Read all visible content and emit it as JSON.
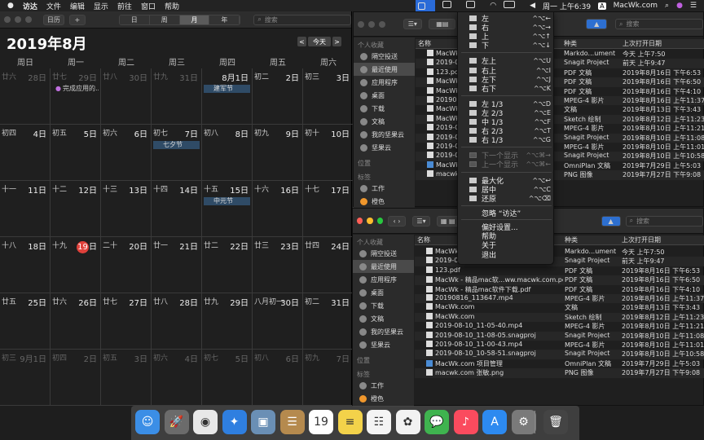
{
  "menubar": {
    "items": [
      "访达",
      "文件",
      "编辑",
      "显示",
      "前往",
      "窗口",
      "帮助"
    ],
    "clock": "周一 上午6:39",
    "site": "MacWk.com"
  },
  "calendar": {
    "toolbar": {
      "calendars_label": "日历",
      "add_label": "+",
      "views": [
        "日",
        "周",
        "月",
        "年"
      ],
      "selected_view": "月",
      "search_placeholder": "搜索"
    },
    "title": "2019年8月",
    "today_button": "今天",
    "prev": "<",
    "next": ">",
    "weekdays": [
      "周日",
      "周一",
      "周二",
      "周三",
      "周四",
      "周五",
      "周六"
    ],
    "weeks": [
      [
        {
          "l": "廿六",
          "d": "28日",
          "dim": true
        },
        {
          "l": "廿七",
          "d": "29日",
          "dim": true
        },
        {
          "l": "廿八",
          "d": "30日",
          "dim": true
        },
        {
          "l": "廿九",
          "d": "31日",
          "dim": true
        },
        {
          "l": "",
          "d": "8月1日"
        },
        {
          "l": "初二",
          "d": "2日"
        },
        {
          "l": "初三",
          "d": "3日"
        }
      ],
      [
        {
          "l": "初四",
          "d": "4日"
        },
        {
          "l": "初五",
          "d": "5日"
        },
        {
          "l": "初六",
          "d": "6日"
        },
        {
          "l": "初七",
          "d": "7日"
        },
        {
          "l": "初八",
          "d": "8日"
        },
        {
          "l": "初九",
          "d": "9日"
        },
        {
          "l": "初十",
          "d": "10日"
        }
      ],
      [
        {
          "l": "十一",
          "d": "11日"
        },
        {
          "l": "十二",
          "d": "12日"
        },
        {
          "l": "十三",
          "d": "13日"
        },
        {
          "l": "十四",
          "d": "14日"
        },
        {
          "l": "十五",
          "d": "15日"
        },
        {
          "l": "十六",
          "d": "16日"
        },
        {
          "l": "十七",
          "d": "17日"
        }
      ],
      [
        {
          "l": "十八",
          "d": "18日"
        },
        {
          "l": "十九",
          "d": "19",
          "today": true
        },
        {
          "l": "二十",
          "d": "20日"
        },
        {
          "l": "廿一",
          "d": "21日"
        },
        {
          "l": "廿二",
          "d": "22日"
        },
        {
          "l": "廿三",
          "d": "23日"
        },
        {
          "l": "廿四",
          "d": "24日"
        }
      ],
      [
        {
          "l": "廿五",
          "d": "25日"
        },
        {
          "l": "廿六",
          "d": "26日"
        },
        {
          "l": "廿七",
          "d": "27日"
        },
        {
          "l": "廿八",
          "d": "28日"
        },
        {
          "l": "廿九",
          "d": "29日"
        },
        {
          "l": "八月初一",
          "d": "30日"
        },
        {
          "l": "初二",
          "d": "31日"
        }
      ],
      [
        {
          "l": "初三",
          "d": "9月1日",
          "dim": true
        },
        {
          "l": "初四",
          "d": "2日",
          "dim": true
        },
        {
          "l": "初五",
          "d": "3日",
          "dim": true
        },
        {
          "l": "初六",
          "d": "4日",
          "dim": true
        },
        {
          "l": "初七",
          "d": "5日",
          "dim": true
        },
        {
          "l": "初八",
          "d": "6日",
          "dim": true
        },
        {
          "l": "初九",
          "d": "7日",
          "dim": true
        }
      ]
    ],
    "events": [
      {
        "w": 0,
        "c": 1,
        "text": "完成应用的...",
        "plain": true
      },
      {
        "w": 0,
        "c": 4,
        "text": "建军节"
      },
      {
        "w": 1,
        "c": 3,
        "text": "七夕节"
      },
      {
        "w": 2,
        "c": 4,
        "text": "中元节"
      }
    ]
  },
  "finder_back": {
    "search_placeholder": "搜索",
    "columns": {
      "name": "名称",
      "kind": "种类",
      "date": "上次打开日期"
    },
    "rows": [
      {
        "name": "MacWk",
        "kind": "Markdo...ument",
        "date": "今天 上午7:50"
      },
      {
        "name": "2019-0",
        "kind": "Snagit Project",
        "date": "前天 上午9:47"
      },
      {
        "name": "123.pdf",
        "kind": "PDF 文稿",
        "date": "2019年8月16日 下午6:53"
      },
      {
        "name": "MacWk",
        "kind": "PDF 文稿",
        "date": "2019年8月16日 下午6:50"
      },
      {
        "name": "MacWk",
        "kind": "PDF 文稿",
        "date": "2019年8月16日 下午4:10"
      },
      {
        "name": "2019081",
        "kind": "MPEG-4 影片",
        "date": "2019年8月16日 上午11:37"
      },
      {
        "name": "MacWk",
        "kind": "文稿",
        "date": "2019年8月13日 下午3:43"
      },
      {
        "name": "MacWk",
        "kind": "Sketch 绘制",
        "date": "2019年8月12日 上午11:23"
      },
      {
        "name": "2019-0",
        "kind": "MPEG-4 影片",
        "date": "2019年8月10日 上午11:21"
      },
      {
        "name": "2019-0",
        "kind": "Snagit Project",
        "date": "2019年8月10日 上午11:08"
      },
      {
        "name": "2019-0",
        "kind": "MPEG-4 影片",
        "date": "2019年8月10日 上午11:01"
      },
      {
        "name": "2019-0",
        "kind": "Snagit Project",
        "date": "2019年8月10日 上午10:58"
      },
      {
        "name": "MacWk",
        "kind": "OmniPlan 文稿",
        "date": "2019年7月29日 上午5:03"
      },
      {
        "name": "macwk",
        "kind": "PNG 图像",
        "date": "2019年7月27日 下午9:08"
      }
    ]
  },
  "finder_front": {
    "search_placeholder": "搜索",
    "sidebar": {
      "fav_label": "个人收藏",
      "favs": [
        "隔空投送",
        "最近使用",
        "应用程序",
        "桌面",
        "下载",
        "文稿",
        "我的坚果云",
        "坚果云"
      ],
      "loc_label": "位置",
      "tag_label": "标签",
      "tags": [
        "工作",
        "橙色"
      ]
    },
    "columns": {
      "name": "名称",
      "kind": "种类",
      "date": "上次打开日期"
    },
    "rows": [
      {
        "name": "MacWk",
        "kind": "Markdo...ument",
        "date": "今天 上午7:50"
      },
      {
        "name": "2019-0",
        "kind": "Snagit Project",
        "date": "前天 上午9:47"
      },
      {
        "name": "123.pdf",
        "kind": "PDF 文稿",
        "date": "2019年8月16日 下午6:53"
      },
      {
        "name": "MacWk - 精品mac软...ww.macwk.com.pdf",
        "kind": "PDF 文稿",
        "date": "2019年8月16日 下午6:50"
      },
      {
        "name": "MacWk - 精品mac软件下载.pdf",
        "kind": "PDF 文稿",
        "date": "2019年8月16日 下午4:10"
      },
      {
        "name": "20190816_113647.mp4",
        "kind": "MPEG-4 影片",
        "date": "2019年8月16日 上午11:37"
      },
      {
        "name": "MacWk.com",
        "kind": "文稿",
        "date": "2019年8月13日 下午3:43"
      },
      {
        "name": "MacWk.com",
        "kind": "Sketch 绘制",
        "date": "2019年8月12日 上午11:23"
      },
      {
        "name": "2019-08-10_11-05-40.mp4",
        "kind": "MPEG-4 影片",
        "date": "2019年8月10日 上午11:21"
      },
      {
        "name": "2019-08-10_11-08-05.snagproj",
        "kind": "Snagit Project",
        "date": "2019年8月10日 上午11:08"
      },
      {
        "name": "2019-08-10_11-00-43.mp4",
        "kind": "MPEG-4 影片",
        "date": "2019年8月10日 上午11:01"
      },
      {
        "name": "2019-08-10_10-58-51.snagproj",
        "kind": "Snagit Project",
        "date": "2019年8月10日 上午10:58"
      },
      {
        "name": "MacWk.com 项目管理",
        "kind": "OmniPlan 文稿",
        "date": "2019年7月29日 上午5:03"
      },
      {
        "name": "macwk.com 张敏.png",
        "kind": "PNG 图像",
        "date": "2019年7月27日 下午9:08"
      }
    ]
  },
  "window_menu": {
    "groups": [
      [
        {
          "label": "左",
          "key": "^⌥←"
        },
        {
          "label": "右",
          "key": "^⌥→"
        },
        {
          "label": "上",
          "key": "^⌥↑"
        },
        {
          "label": "下",
          "key": "^⌥↓"
        }
      ],
      [
        {
          "label": "左上",
          "key": "^⌥U"
        },
        {
          "label": "右上",
          "key": "^⌥I"
        },
        {
          "label": "左下",
          "key": "^⌥J"
        },
        {
          "label": "右下",
          "key": "^⌥K"
        }
      ],
      [
        {
          "label": "左 1/3",
          "key": "^⌥D"
        },
        {
          "label": "左 2/3",
          "key": "^⌥E"
        },
        {
          "label": "中 1/3",
          "key": "^⌥F"
        },
        {
          "label": "右 2/3",
          "key": "^⌥T"
        },
        {
          "label": "右 1/3",
          "key": "^⌥G"
        }
      ],
      [
        {
          "label": "下一个显示",
          "key": "^⌥⌘→",
          "disabled": true
        },
        {
          "label": "上一个显示",
          "key": "^⌥⌘←",
          "disabled": true
        }
      ],
      [
        {
          "label": "最大化",
          "key": "^⌥↩"
        },
        {
          "label": "居中",
          "key": "^⌥C"
        },
        {
          "label": "还原",
          "key": "^⌥⌫"
        }
      ]
    ],
    "ignore": "忽略 “访达”",
    "footer": [
      "偏好设置...",
      "帮助",
      "关于",
      "退出"
    ]
  },
  "dock": {
    "apps": [
      {
        "name": "finder",
        "color": "#3b8ee6",
        "glyph": "☺"
      },
      {
        "name": "launchpad",
        "color": "#6b6b6b",
        "glyph": "🚀"
      },
      {
        "name": "chrome",
        "color": "#e8e8e8",
        "glyph": "◉"
      },
      {
        "name": "safari",
        "color": "#2f7fe0",
        "glyph": "✦"
      },
      {
        "name": "preview",
        "color": "#6a8fb5",
        "glyph": "▣"
      },
      {
        "name": "contacts",
        "color": "#b58a4e",
        "glyph": "☰"
      },
      {
        "name": "calendar",
        "color": "#ffffff",
        "glyph": "19"
      },
      {
        "name": "notes",
        "color": "#f3d24a",
        "glyph": "≡"
      },
      {
        "name": "reminders",
        "color": "#f4f4f4",
        "glyph": "☷"
      },
      {
        "name": "photos",
        "color": "#f2f2f2",
        "glyph": "✿"
      },
      {
        "name": "messages",
        "color": "#3fb34f",
        "glyph": "💬"
      },
      {
        "name": "music",
        "color": "#fa4b5e",
        "glyph": "♪"
      },
      {
        "name": "app-store",
        "color": "#2d8af0",
        "glyph": "A"
      },
      {
        "name": "system-preferences",
        "color": "#7a7a7a",
        "glyph": "⚙"
      },
      {
        "name": "trash",
        "color": "#444444",
        "glyph": "🗑"
      }
    ]
  }
}
